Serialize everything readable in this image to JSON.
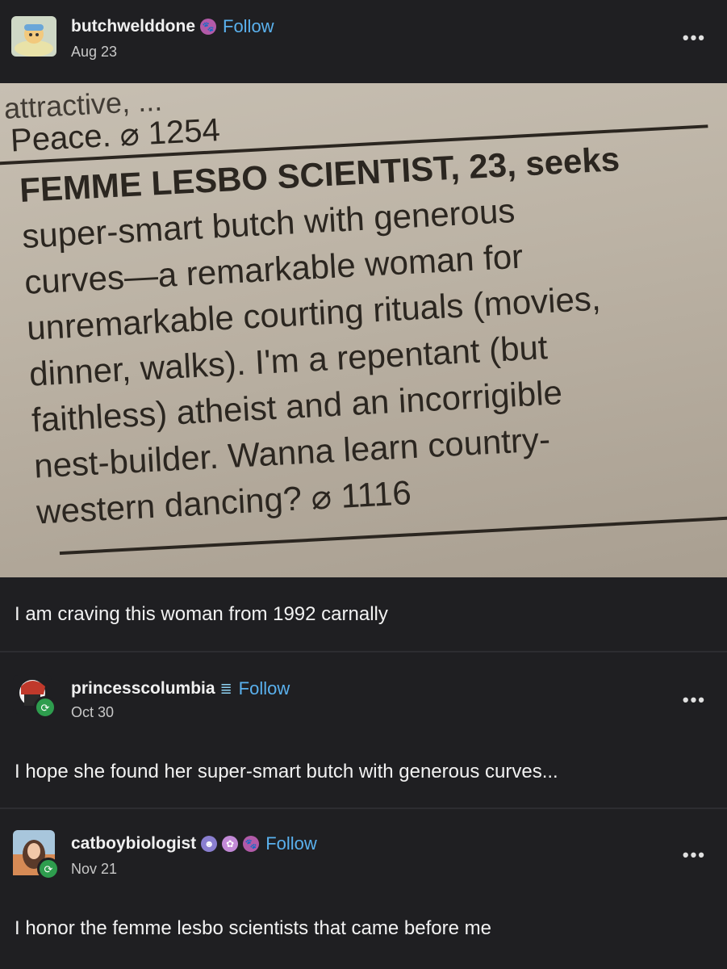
{
  "post": {
    "username": "butchwelddone",
    "follow_label": "Follow",
    "date": "Aug 23",
    "photo": {
      "clipped_top_line": "attractive, ...",
      "peace_line": "Peace. ⌀ 1254",
      "headline": "FEMME LESBO SCIENTIST,",
      "ad_lines": [
        "FEMME LESBO SCIENTIST, 23, seeks",
        "super-smart butch with generous",
        "curves—a remarkable woman for",
        "unremarkable courting rituals (movies,",
        "dinner, walks). I'm a repentant (but",
        "faithless) atheist and an incorrigible",
        "nest-builder. Wanna learn country-",
        "western dancing? ⌀ 1116"
      ]
    },
    "caption": "I am craving this woman from 1992 carnally"
  },
  "reblogs": [
    {
      "username": "princesscolumbia",
      "follow_label": "Follow",
      "date": "Oct 30",
      "text": "I hope she found her super-smart butch with generous curves..."
    },
    {
      "username": "catboybiologist",
      "follow_label": "Follow",
      "date": "Nov 21",
      "text": "I honor the femme lesbo scientists that came before me"
    }
  ],
  "more_label": "•••",
  "colors": {
    "background": "#1f1f22",
    "follow": "#5ab1ee",
    "reblog_badge": "#2e9d4e"
  }
}
